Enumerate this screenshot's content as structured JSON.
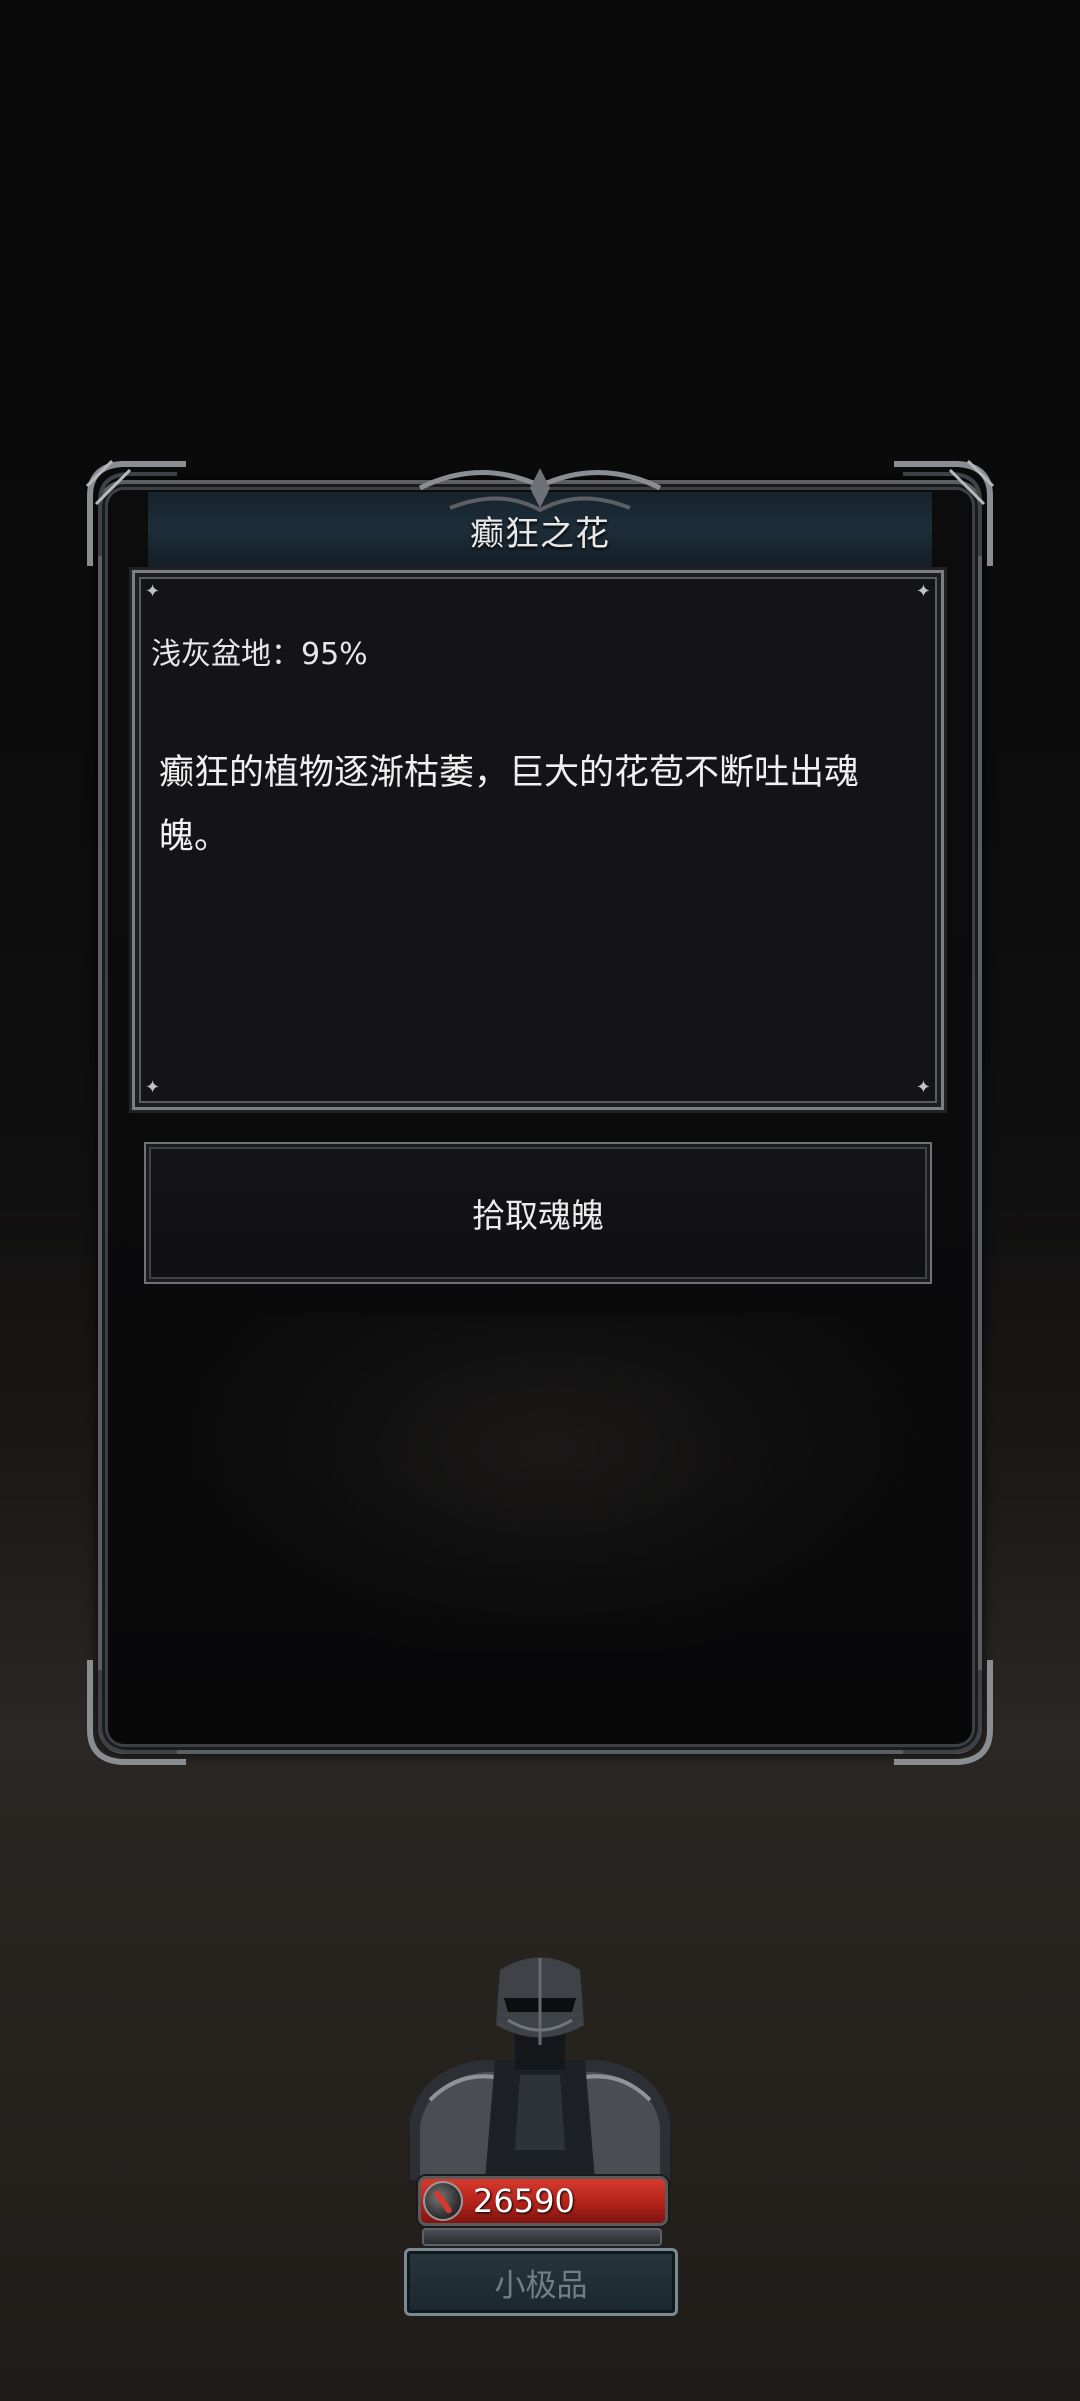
{
  "event": {
    "title": "癫狂之花",
    "region_progress": "浅灰盆地：95%",
    "description": "癫狂的植物逐渐枯萎，巨大的花苞不断吐出魂魄。",
    "action_label": "拾取魂魄"
  },
  "player": {
    "soul_count": "26590",
    "rank": "小极品"
  },
  "icons": {
    "currency": "soul-blade-icon"
  },
  "colors": {
    "gold_bar": "#c22a20",
    "panel_border": "#5b5e63",
    "header_bg": "#1d2d39"
  }
}
